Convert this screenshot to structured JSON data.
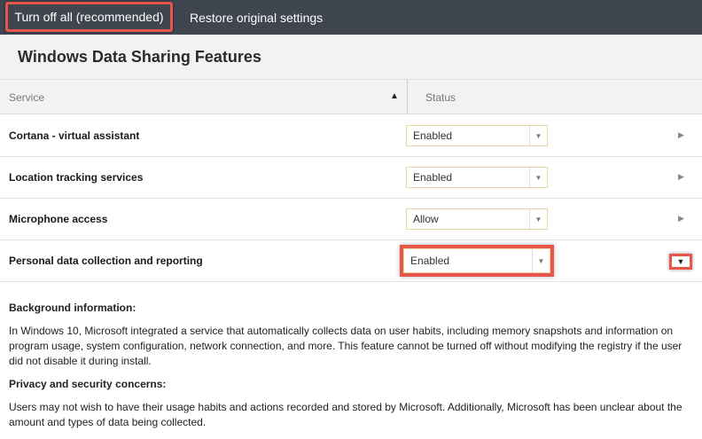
{
  "toolbar": {
    "turn_off_all_label": "Turn off all (recommended)",
    "restore_label": "Restore original settings"
  },
  "title": "Windows Data Sharing Features",
  "columns": {
    "service": "Service",
    "status": "Status"
  },
  "rows": [
    {
      "label": "Cortana - virtual assistant",
      "value": "Enabled"
    },
    {
      "label": "Location tracking services",
      "value": "Enabled"
    },
    {
      "label": "Microphone access",
      "value": "Allow"
    },
    {
      "label": "Personal data collection and reporting",
      "value": "Enabled"
    }
  ],
  "details": {
    "background_heading": "Background information:",
    "background_text": "In Windows 10, Microsoft integrated a service that automatically collects data on user habits, including memory snapshots and information on program usage, system configuration, network connection, and more. This feature cannot be turned off without modifying the registry if the user did not disable it during install.",
    "privacy_heading": "Privacy and security concerns:",
    "privacy_text": "Users may not wish to have their usage habits and actions recorded and stored by Microsoft. Additionally, Microsoft has been unclear about the amount and types of data being collected."
  },
  "colors": {
    "toolbar_bg": "#3f4650",
    "highlight": "#e8554a",
    "header_bg": "#f2f2f2"
  },
  "icons": {
    "sort": "sort-ascending-icon",
    "dropdown": "chevron-down-icon",
    "expand": "chevron-right-icon",
    "collapse": "chevron-down-icon"
  }
}
